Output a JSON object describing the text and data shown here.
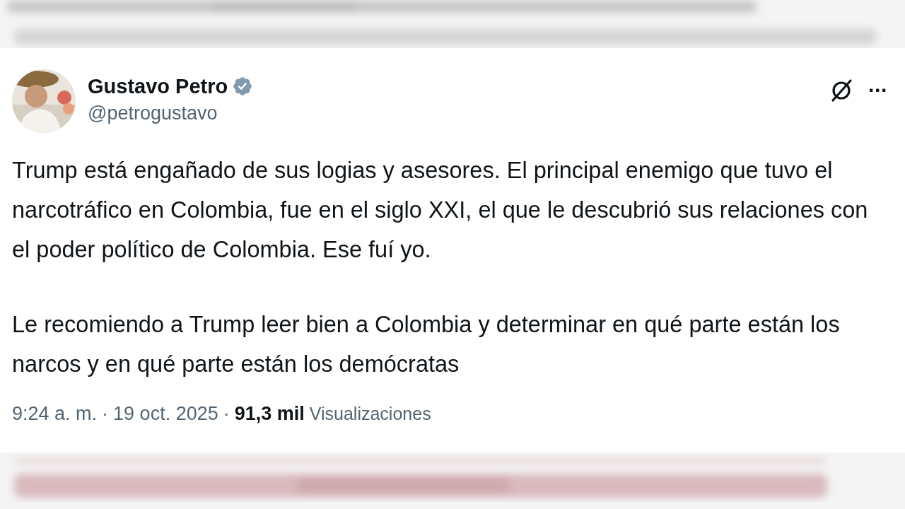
{
  "post": {
    "author": {
      "name": "Gustavo Petro",
      "handle": "@petrogustavo",
      "verified": true
    },
    "more_label": "···",
    "paragraphs": [
      "Trump está engañado de sus logias y asesores. El principal enemigo que tuvo el narcotráfico en Colombia, fue en el siglo XXI, el que le descubrió sus relaciones con el poder político de Colombia. Ese fuí yo.",
      "Le recomiendo a Trump leer bien a Colombia y determinar en qué parte están los narcos y en qué parte están los demócratas"
    ],
    "meta": {
      "time": "9:24 a. m.",
      "separator_1": "·",
      "date": "19 oct. 2025",
      "separator_2": "·",
      "views_count": "91,3 mil",
      "views_label": "Visualizaciones"
    }
  }
}
